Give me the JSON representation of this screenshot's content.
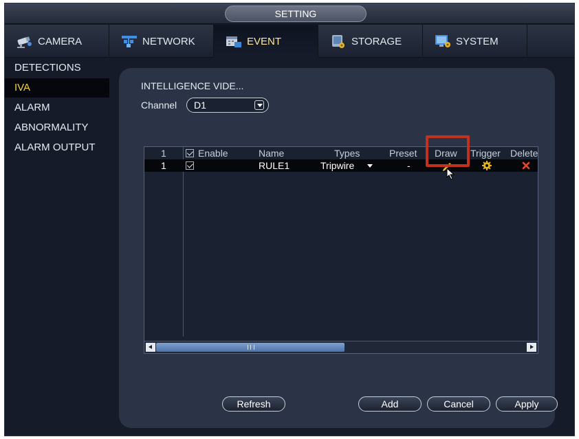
{
  "window": {
    "title": "SETTING"
  },
  "tabs": [
    {
      "label": "CAMERA",
      "icon": "camera-icon",
      "active": false
    },
    {
      "label": "NETWORK",
      "icon": "network-icon",
      "active": false
    },
    {
      "label": "EVENT",
      "icon": "event-icon",
      "active": true
    },
    {
      "label": "STORAGE",
      "icon": "storage-icon",
      "active": false
    },
    {
      "label": "SYSTEM",
      "icon": "system-icon",
      "active": false
    }
  ],
  "sidebar": {
    "items": [
      {
        "label": "DETECTIONS",
        "active": false
      },
      {
        "label": "IVA",
        "active": true
      },
      {
        "label": "ALARM",
        "active": false
      },
      {
        "label": "ABNORMALITY",
        "active": false
      },
      {
        "label": "ALARM OUTPUT",
        "active": false
      }
    ]
  },
  "main": {
    "section_title": "INTELLIGENCE VIDE...",
    "channel_label": "Channel",
    "channel_value": "D1",
    "table": {
      "columns": [
        "1",
        "Enable",
        "Name",
        "Types",
        "Preset",
        "Draw",
        "Trigger",
        "Delete"
      ],
      "header_enable_checked": true,
      "rows": [
        {
          "index": "1",
          "enabled": true,
          "name": "RULE1",
          "type": "Tripwire",
          "preset": "-",
          "draw_icon": "pencil-icon",
          "trigger_icon": "gear-icon",
          "delete_icon": "close-icon"
        }
      ]
    },
    "buttons": {
      "refresh": "Refresh",
      "add": "Add",
      "cancel": "Cancel",
      "apply": "Apply"
    }
  },
  "colors": {
    "background": "#151b29",
    "panel": "#2b3446",
    "active_menu_text": "#f3d23a",
    "active_tab_text": "#ffe7a0",
    "highlight_box": "#c2301e",
    "trigger_gear": "#e3b51c",
    "delete_x": "#e8462b",
    "scroll_thumb": "#6f93c6"
  }
}
